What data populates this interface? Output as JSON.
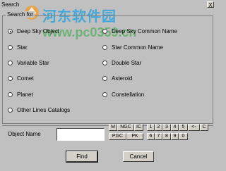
{
  "window": {
    "title": "Search",
    "close_glyph": "X"
  },
  "group": {
    "label": "Search for"
  },
  "options_left": [
    {
      "label": "Deep Sky Object",
      "checked": true
    },
    {
      "label": "Star",
      "checked": false
    },
    {
      "label": "Variable Star",
      "checked": false
    },
    {
      "label": "Comet",
      "checked": false
    },
    {
      "label": "Planet",
      "checked": false
    },
    {
      "label": "Other Lines Catalogs",
      "checked": false
    }
  ],
  "options_right": [
    {
      "label": "Deep Sky Common Name",
      "checked": false
    },
    {
      "label": "Star Common Name",
      "checked": false
    },
    {
      "label": "Double Star",
      "checked": false
    },
    {
      "label": "Asteroid",
      "checked": false
    },
    {
      "label": "Constellation",
      "checked": false
    }
  ],
  "object_name": {
    "label": "Object Name",
    "value": ""
  },
  "keypad": {
    "row1": [
      "M",
      "NGC",
      "IC",
      "1",
      "2",
      "3",
      "4",
      "5",
      "<-",
      "C"
    ],
    "row2": [
      "PGC",
      "PK",
      "6",
      "7",
      "8",
      "9",
      "0"
    ]
  },
  "buttons": {
    "find": "Find",
    "cancel": "Cancel"
  },
  "watermark": {
    "text": "河东软件园",
    "url": "www.pc0359.cn"
  }
}
